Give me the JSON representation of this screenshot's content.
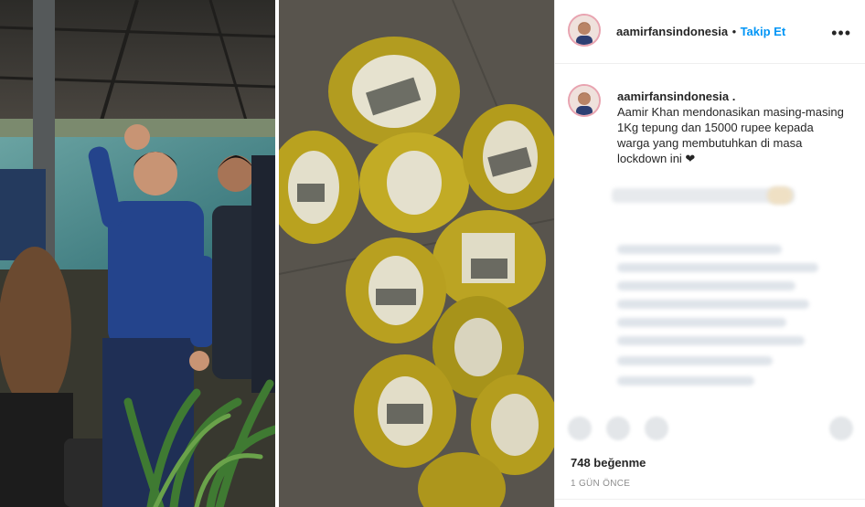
{
  "post": {
    "username": "aamirfansindonesia",
    "separator": "•",
    "follow_label": "Takip Et",
    "more_label": "•••",
    "caption_username": "aamirfansindonesia .",
    "caption_text": "Aamir Khan mendonasikan masing-masing 1Kg tepung dan 15000 rupee kepada warga yang membutuhkan di masa lockdown ini ❤",
    "likes": "748 beğenme",
    "time": "1 GÜN ÖNCE"
  },
  "colors": {
    "accent": "#0095f6",
    "text": "#262626",
    "muted": "#8e8e8e"
  }
}
